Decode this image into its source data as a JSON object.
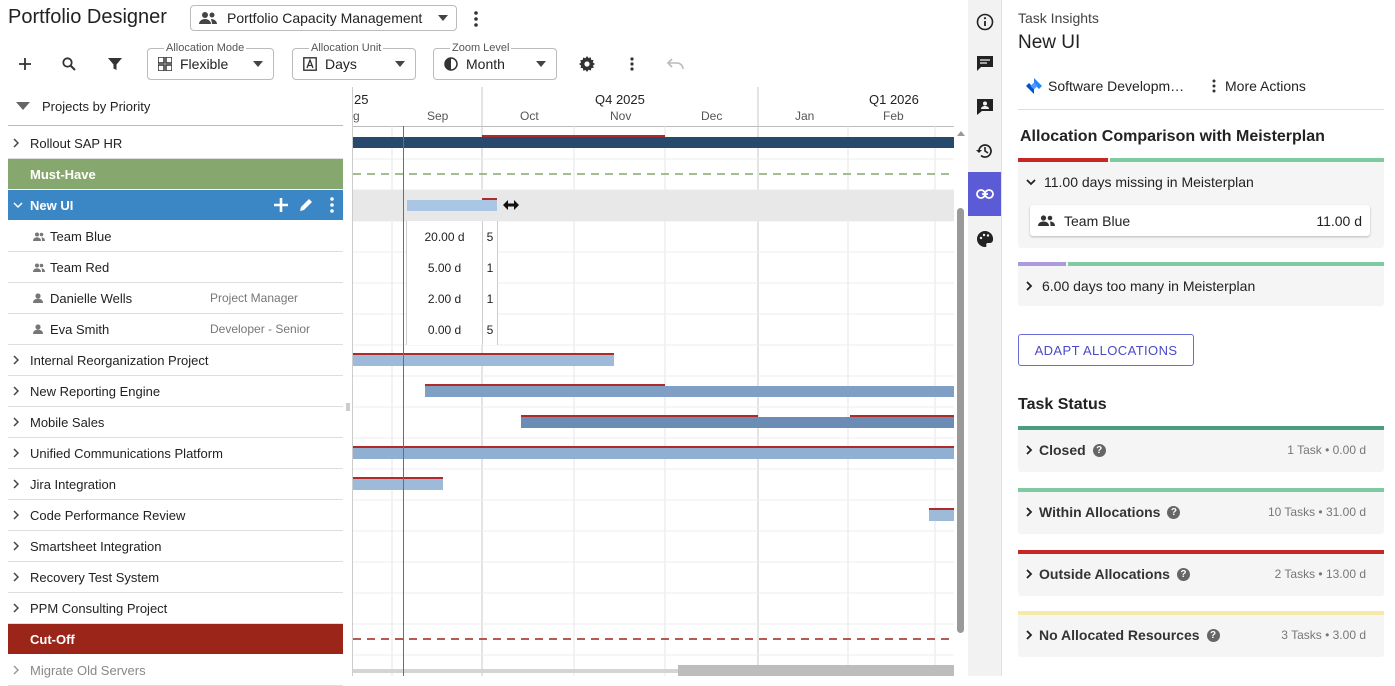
{
  "header": {
    "app_title": "Portfolio Designer",
    "view_select": "Portfolio Capacity Management",
    "allocation_mode": {
      "legend": "Allocation Mode",
      "value": "Flexible"
    },
    "allocation_unit": {
      "legend": "Allocation Unit",
      "value": "Days"
    },
    "zoom_level": {
      "legend": "Zoom Level",
      "value": "Month"
    }
  },
  "tree": {
    "root_label": "Projects by Priority",
    "rows": [
      {
        "label": "Rollout SAP HR"
      },
      {
        "label": "Must-Have"
      },
      {
        "label": "New UI"
      },
      {
        "label": "Team Blue"
      },
      {
        "label": "Team Red"
      },
      {
        "label": "Danielle Wells",
        "role": "Project Manager"
      },
      {
        "label": "Eva Smith",
        "role": "Developer - Senior"
      },
      {
        "label": "Internal Reorganization Project"
      },
      {
        "label": "New Reporting Engine"
      },
      {
        "label": "Mobile Sales"
      },
      {
        "label": "Unified Communications Platform"
      },
      {
        "label": "Jira Integration"
      },
      {
        "label": "Code Performance Review"
      },
      {
        "label": "Smartsheet Integration"
      },
      {
        "label": "Recovery Test System"
      },
      {
        "label": "PPM Consulting Project"
      },
      {
        "label": "Cut-Off"
      },
      {
        "label": "Migrate Old Servers"
      }
    ]
  },
  "timeline": {
    "year_prefix": "25",
    "quarters": [
      "Q4 2025",
      "Q1 2026"
    ],
    "months": [
      "Sep",
      "Oct",
      "Nov",
      "Dec",
      "Jan",
      "Feb"
    ]
  },
  "allocations": [
    {
      "value": "20.00 d",
      "extra": "5"
    },
    {
      "value": "5.00 d",
      "extra": "1"
    },
    {
      "value": "2.00 d",
      "extra": "1"
    },
    {
      "value": "0.00 d",
      "extra": "5"
    }
  ],
  "panel": {
    "subtitle": "Task Insights",
    "title": "New UI",
    "integration": "Software Developm…",
    "more_actions": "More Actions",
    "comparison_heading": "Allocation Comparison with Meisterplan",
    "missing": {
      "label": "11.00 days missing in Meisterplan",
      "team": "Team Blue",
      "value": "11.00 d"
    },
    "too_many": {
      "label": "6.00 days too many in Meisterplan"
    },
    "adapt_button": "ADAPT ALLOCATIONS",
    "status_heading": "Task Status",
    "statuses": [
      {
        "label": "Closed",
        "meta": "1 Task • 0.00 d",
        "color": "#4a9e7f"
      },
      {
        "label": "Within Allocations",
        "meta": "10 Tasks • 31.00 d",
        "color": "#7ecba1"
      },
      {
        "label": "Outside Allocations",
        "meta": "2 Tasks • 13.00 d",
        "color": "#c62828"
      },
      {
        "label": "No Allocated Resources",
        "meta": "3 Tasks • 3.00 d",
        "color": "#f7e9a6"
      }
    ]
  },
  "colors": {
    "must_have": "#86a86e",
    "cut_off": "#9b2519",
    "selected": "#3b86c4",
    "rail_active": "#5b5bd6",
    "bar_dark": "#27496d",
    "bar_mid": "#7f9fc4",
    "bar_light": "#9dbad8"
  },
  "icons": [
    "add-icon",
    "search-icon",
    "filter-icon",
    "settings-icon",
    "more-vert-icon",
    "undo-icon",
    "info-icon",
    "comments-icon",
    "contact-card-icon",
    "history-icon",
    "link-icon",
    "palette-icon"
  ]
}
